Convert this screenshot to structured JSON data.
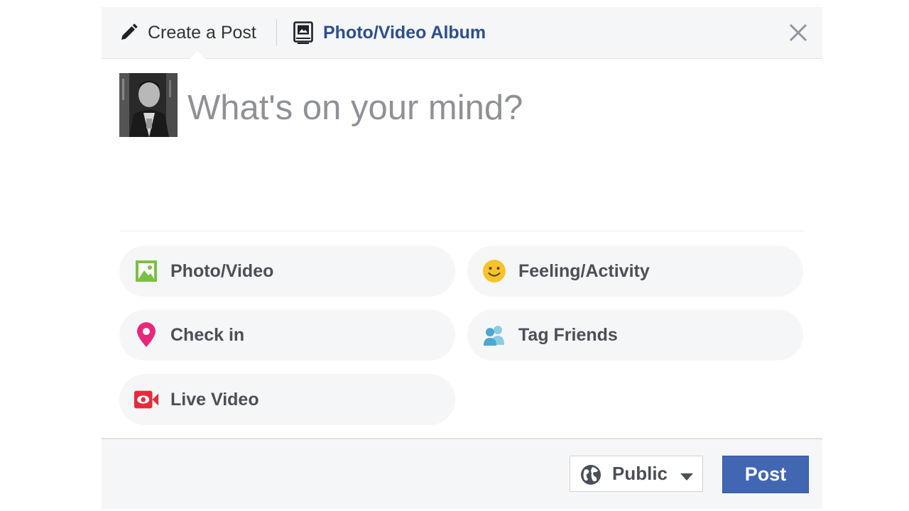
{
  "header": {
    "tabs": [
      {
        "label": "Create a Post",
        "icon": "pencil-icon",
        "active": true
      },
      {
        "label": "Photo/Video Album",
        "icon": "album-icon",
        "active": false
      }
    ],
    "close_icon": "close-icon"
  },
  "composer": {
    "placeholder": "What's on your mind?",
    "avatar": "profile-photo"
  },
  "actions": [
    {
      "label": "Photo/Video",
      "icon": "photo-icon",
      "color": "#7bc043"
    },
    {
      "label": "Feeling/Activity",
      "icon": "smiley-icon",
      "color": "#f7c32b"
    },
    {
      "label": "Check in",
      "icon": "location-pin-icon",
      "color": "#e9287b"
    },
    {
      "label": "Tag Friends",
      "icon": "tag-friends-icon",
      "color": "#6cb6d8"
    },
    {
      "label": "Live Video",
      "icon": "live-video-icon",
      "color": "#e42b3d"
    }
  ],
  "footer": {
    "privacy_label": "Public",
    "privacy_icon": "globe-icon",
    "post_label": "Post"
  },
  "colors": {
    "brand": "#4267b2",
    "album_link": "#2d4f8e",
    "header_bg": "#f5f6f7"
  }
}
